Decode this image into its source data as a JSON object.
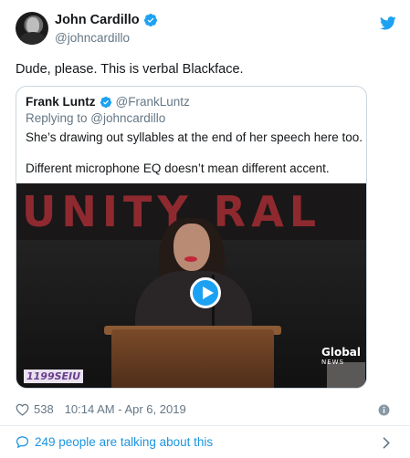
{
  "author": {
    "name": "John Cardillo",
    "handle": "@johncardillo",
    "verified": true
  },
  "tweet_text": "Dude, please. This is verbal Blackface.",
  "quoted": {
    "name": "Frank Luntz",
    "handle": "@FrankLuntz",
    "reply_prefix": "Replying to ",
    "reply_mention": "@johncardillo",
    "line1": "She’s drawing out syllables at the end of her speech here too.",
    "line2": "Different microphone EQ doesn’t mean different accent.",
    "media": {
      "banner_text": "UNITY RAL",
      "sign_text": "1199SEIU",
      "network": "Global",
      "network_sub": "NEWS",
      "play_icon": "play-icon"
    }
  },
  "footer": {
    "likes": "538",
    "timestamp": "10:14 AM - Apr 6, 2019",
    "talking": "249 people are talking about this"
  },
  "colors": {
    "accent": "#1da1f2",
    "link": "#1b95e0",
    "muted": "#657786",
    "banner_red": "#8e2a2f"
  },
  "icons": [
    "verified-badge-icon",
    "twitter-bird-icon",
    "heart-icon",
    "info-icon",
    "chat-bubble-icon",
    "chevron-right-icon",
    "play-icon"
  ]
}
